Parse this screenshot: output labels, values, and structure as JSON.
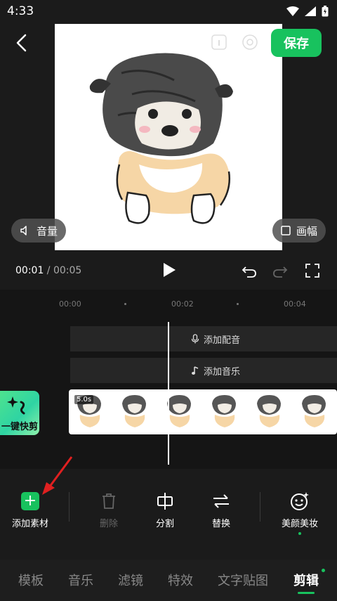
{
  "status_bar": {
    "time": "4:33"
  },
  "header": {
    "save_label": "保存"
  },
  "preview": {
    "volume_label": "音量",
    "canvas_label": "画幅"
  },
  "playback": {
    "current_time": "00:01",
    "separator": " / ",
    "total_time": "00:05"
  },
  "timeline": {
    "ticks": [
      "00:00",
      "00:02",
      "00:04"
    ],
    "add_voiceover_label": "添加配音",
    "add_music_label": "添加音乐",
    "clip_duration": "5.0s",
    "quick_cut_label": "一键快剪"
  },
  "toolbar": {
    "add_material_label": "添加素材",
    "delete_label": "删除",
    "split_label": "分割",
    "replace_label": "替换",
    "beauty_label": "美颜美妆"
  },
  "bottom_tabs": [
    "模板",
    "音乐",
    "滤镜",
    "特效",
    "文字贴图",
    "剪辑"
  ],
  "colors": {
    "accent": "#18c25e",
    "background": "#1b1b1b"
  }
}
